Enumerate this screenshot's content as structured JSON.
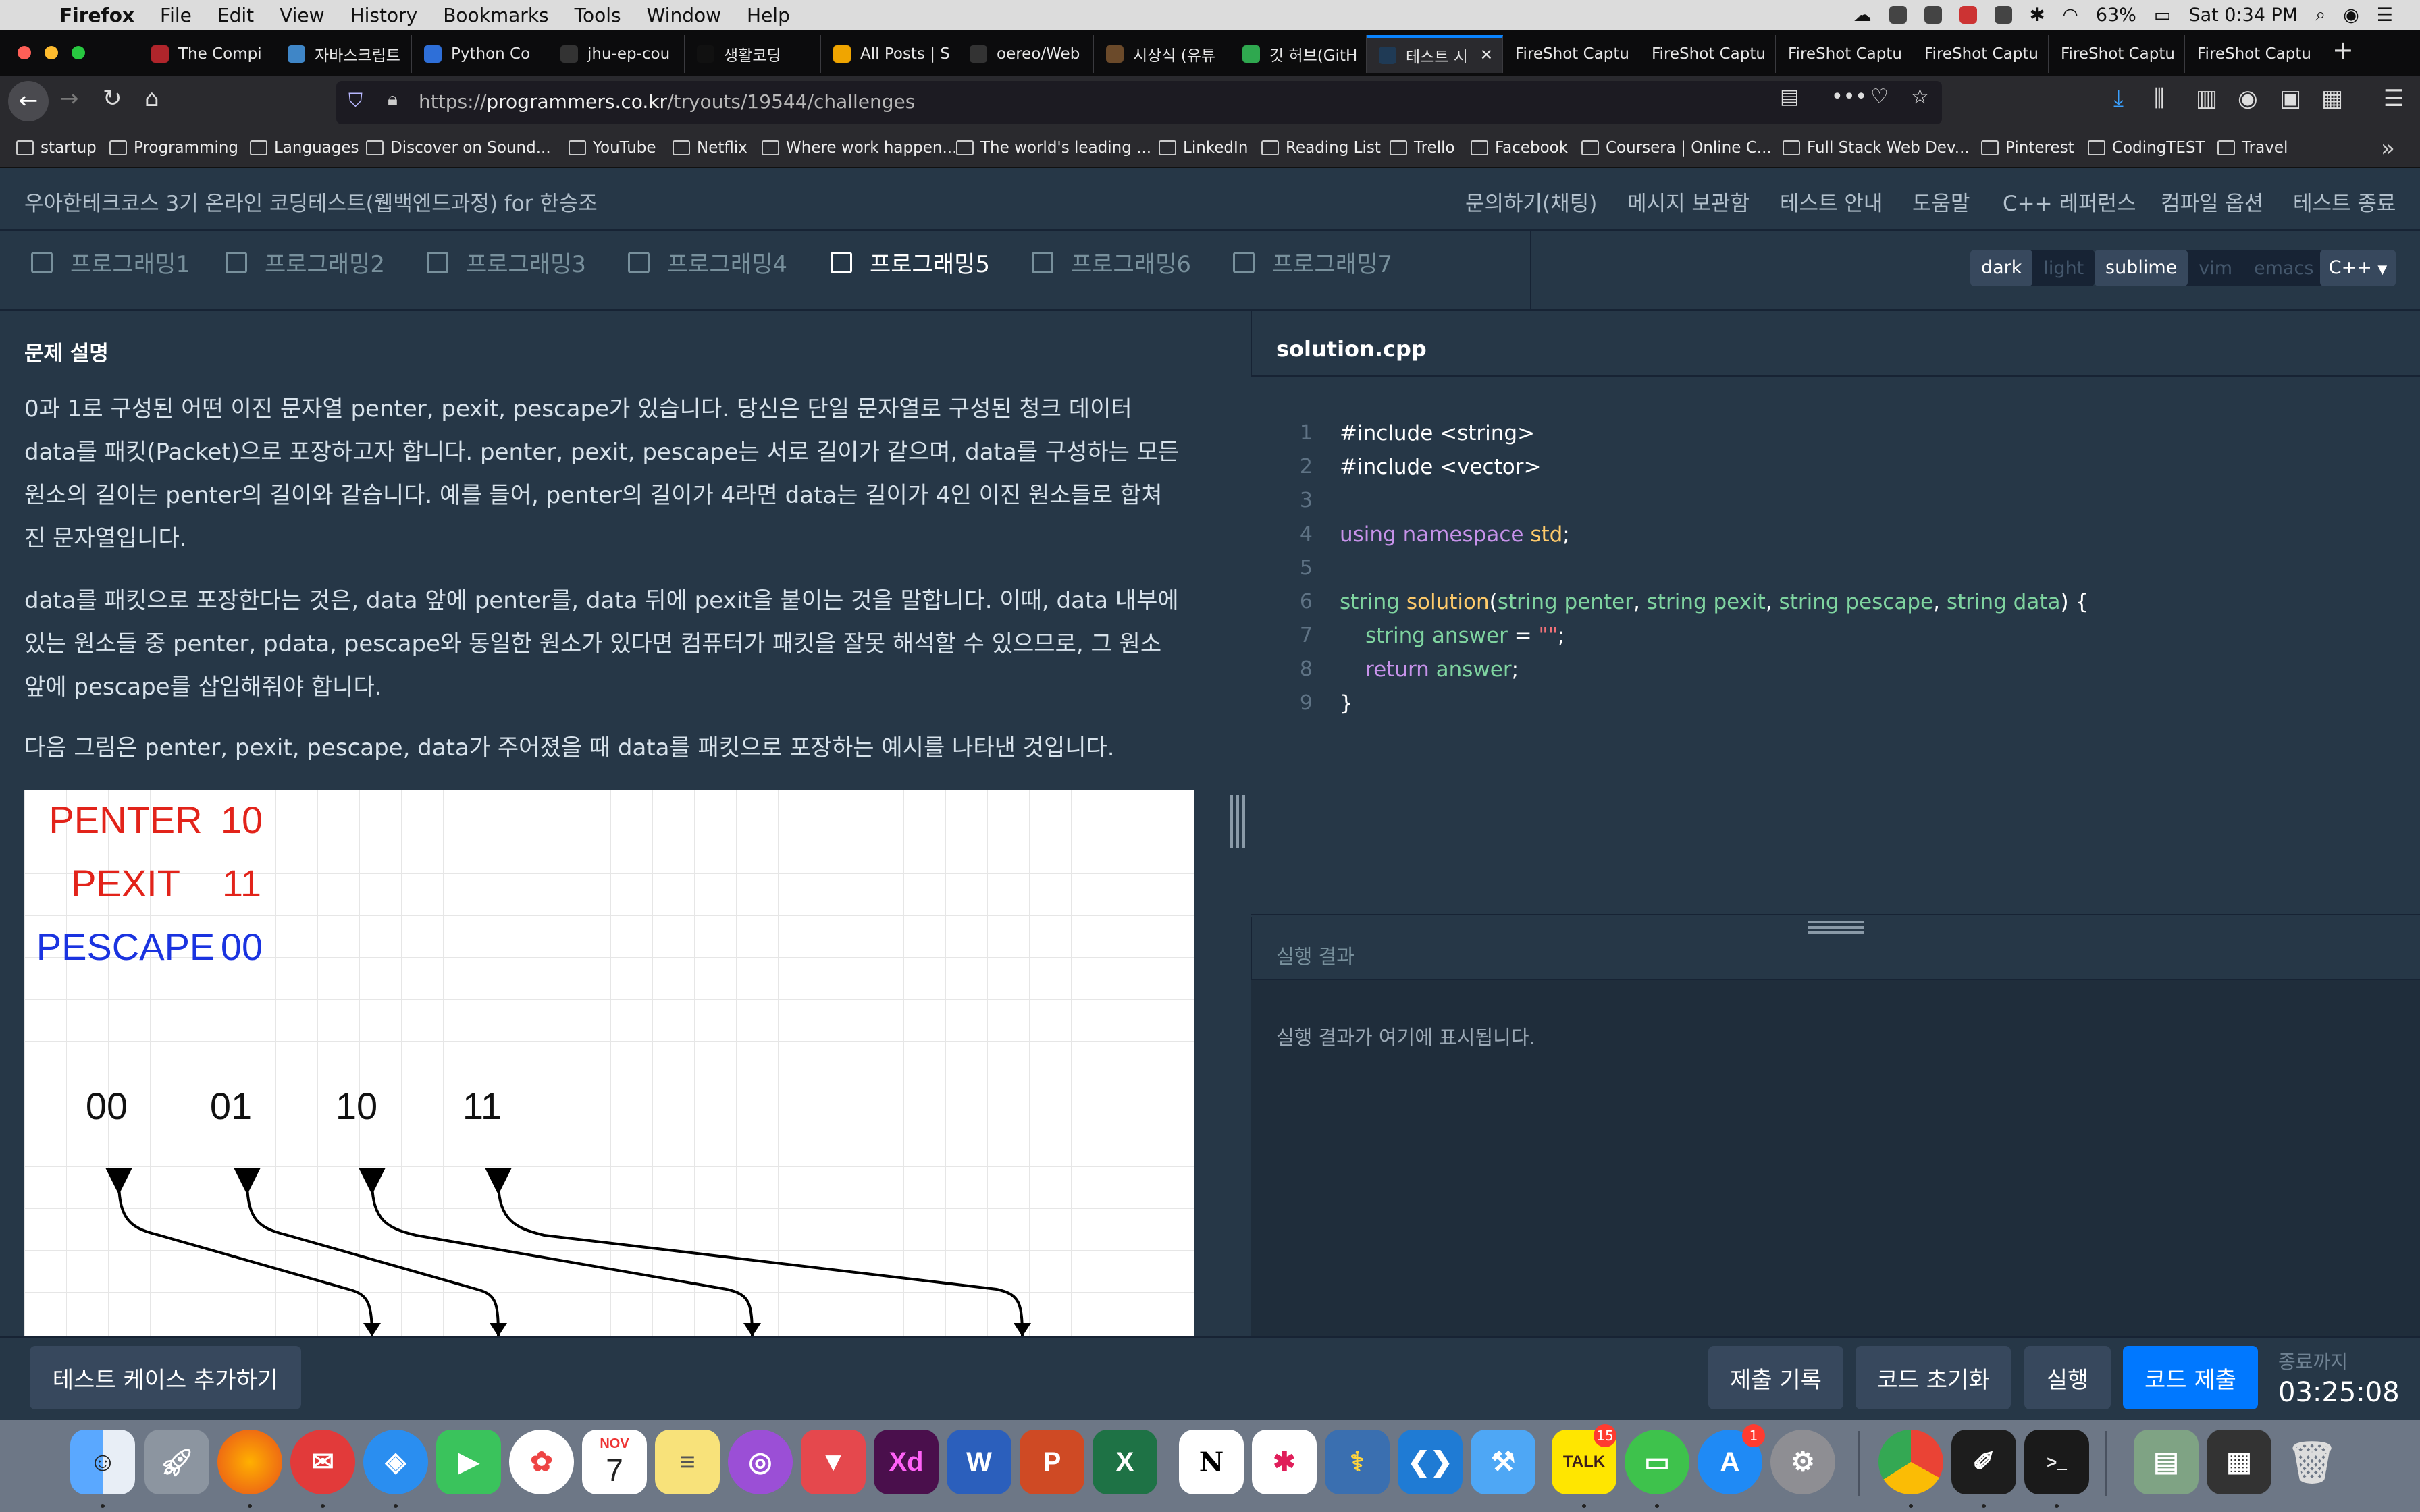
{
  "menubar": {
    "app": "Firefox",
    "items": [
      "File",
      "Edit",
      "View",
      "History",
      "Bookmarks",
      "Tools",
      "Window",
      "Help"
    ],
    "battery": "63%",
    "clock": "Sat 0:34 PM"
  },
  "browser_tabs": [
    {
      "label": "The Compi",
      "color": "#b0252b"
    },
    {
      "label": "자바스크립트",
      "color": "#3f86c7"
    },
    {
      "label": "Python Co",
      "color": "#2e6fd8"
    },
    {
      "label": "jhu-ep-cou",
      "color": "#333"
    },
    {
      "label": "생활코딩",
      "color": "#111"
    },
    {
      "label": "All Posts | S",
      "color": "#f0a500"
    },
    {
      "label": "oereo/Web",
      "color": "#333"
    },
    {
      "label": "시상식 (유튜",
      "color": "#6b4a2a"
    },
    {
      "label": "깃 허브(GitH",
      "color": "#2fa84f"
    },
    {
      "label": "테스트 시",
      "color": "#1f3a55"
    },
    {
      "label": "FireShot Captu",
      "color": ""
    },
    {
      "label": "FireShot Captu",
      "color": ""
    },
    {
      "label": "FireShot Captu",
      "color": ""
    },
    {
      "label": "FireShot Captu",
      "color": ""
    },
    {
      "label": "FireShot Captu",
      "color": ""
    },
    {
      "label": "FireShot Captu",
      "color": ""
    }
  ],
  "url": {
    "prefix": "https://",
    "domain": "programmers.co.kr",
    "path": "/tryouts/19544/challenges"
  },
  "bookmarks": [
    "startup",
    "Programming",
    "Languages",
    "Discover on Sound...",
    "YouTube",
    "Netflix",
    "Where work happen...",
    "The world's leading ...",
    "LinkedIn",
    "Reading List",
    "Trello",
    "Facebook",
    "Coursera | Online C...",
    "Full Stack Web Dev...",
    "Pinterest",
    "CodingTEST",
    "Travel"
  ],
  "page": {
    "title": "우아한테크코스 3기 온라인 코딩테스트(웹백엔드과정) for 한승조",
    "menu": [
      "문의하기(채팅)",
      "메시지 보관함",
      "테스트 안내",
      "도움말",
      "C++ 레퍼런스",
      "컴파일 옵션",
      "테스트 종료"
    ]
  },
  "problem_tabs": [
    "프로그래밍1",
    "프로그래밍2",
    "프로그래밍3",
    "프로그래밍4",
    "프로그래밍5",
    "프로그래밍6",
    "프로그래밍7"
  ],
  "current_tab": "프로그래밍5",
  "theme_toggle": {
    "dark": "dark",
    "light": "light"
  },
  "keymap_toggle": {
    "sublime": "sublime",
    "vim": "vim",
    "emacs": "emacs"
  },
  "language": "C++",
  "description": {
    "heading": "문제 설명",
    "p1_lines": [
      "0과 1로 구성된 어떤 이진 문자열 penter, pexit, pescape가 있습니다. 당신은 단일 문자열로 구성된 청크 데이터",
      "data를 패킷(Packet)으로 포장하고자 합니다. penter, pexit, pescape는 서로 길이가 같으며, data를 구성하는 모든",
      "원소의 길이는 penter의 길이와 같습니다. 예를 들어, penter의 길이가 4라면 data는 길이가 4인 이진 원소들로 합쳐",
      "진 문자열입니다."
    ],
    "p2_lines": [
      "data를 패킷으로 포장한다는 것은, data 앞에 penter를, data 뒤에 pexit을 붙이는 것을 말합니다. 이때, data 내부에",
      "있는 원소들 중 penter, pdata, pescape와 동일한 원소가 있다면 컴퓨터가 패킷을 잘못 해석할 수 있으므로, 그 원소",
      "앞에 pescape를 삽입해줘야 합니다."
    ],
    "p3": "다음 그림은 penter, pexit, pescape, data가 주어졌을 때 data를 패킷으로 포장하는 예시를 나타낸 것입니다."
  },
  "figure": {
    "rows": [
      {
        "name": "PENTER",
        "value": "10",
        "color": "#e2231a"
      },
      {
        "name": "PEXIT",
        "value": "11",
        "color": "#e2231a"
      },
      {
        "name": "PESCAPE",
        "value": "00",
        "color": "#1a33e0"
      }
    ],
    "data_elems": [
      "00",
      "01",
      "10",
      "11"
    ]
  },
  "editor": {
    "filename": "solution.cpp",
    "line_numbers": [
      "1",
      "2",
      "3",
      "4",
      "5",
      "6",
      "7",
      "8",
      "9"
    ],
    "l1": "#include <string>",
    "l2": "#include <vector>",
    "l4a": "using namespace ",
    "l4b": "std",
    "l4c": ";",
    "l6a": "string ",
    "l6b": "solution",
    "l6c": "(",
    "l6d": "string penter",
    "l6e": ", ",
    "l6f": "string pexit",
    "l6g": ", ",
    "l6h": "string pescape",
    "l6i": ", ",
    "l6j": "string data",
    "l6k": ") {",
    "l7a": "string answer",
    "l7b": " = ",
    "l7c": "\"\"",
    "l7d": ";",
    "l8a": "return ",
    "l8b": "answer",
    "l8c": ";",
    "l9": "}"
  },
  "result": {
    "heading": "실행 결과",
    "placeholder": "실행 결과가 여기에 표시됩니다."
  },
  "buttons": {
    "add_testcase": "테스트 케이스 추가하기",
    "history": "제출 기록",
    "reset": "코드 초기화",
    "run": "실행",
    "submit": "코드 제출"
  },
  "timer": {
    "label": "종료까지",
    "value": "03:25:08"
  },
  "dock": {
    "calendar_month": "NOV",
    "calendar_day": "7",
    "kakao_badge": "15",
    "appstore_badge": "1",
    "kakao_label": "TALK"
  }
}
